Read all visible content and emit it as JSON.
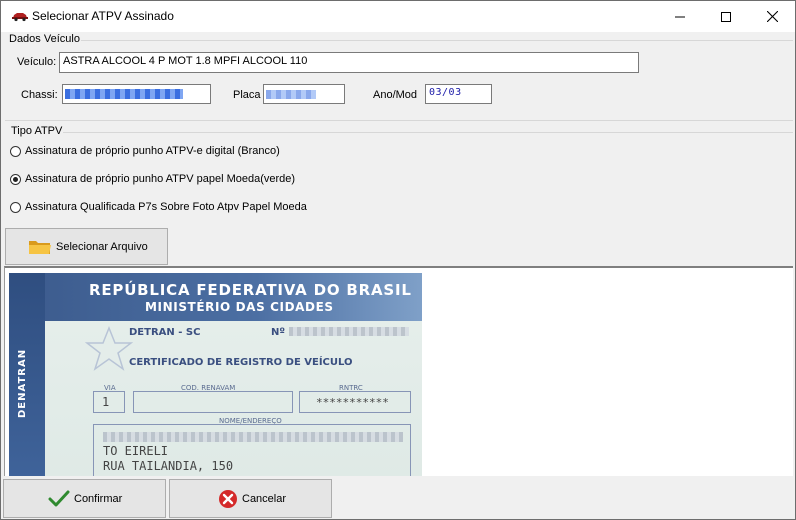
{
  "window": {
    "title": "Selecionar ATPV Assinado",
    "minimize_icon": "minimize-icon",
    "maximize_icon": "maximize-icon",
    "close_icon": "close-icon"
  },
  "dados_veiculo": {
    "group_label": "Dados Veículo",
    "veiculo_label": "Veículo:",
    "veiculo_value": "ASTRA ALCOOL 4 P MOT 1.8 MPFI ALCOOL 110",
    "chassi_label": "Chassi:",
    "placa_label": "Placa",
    "anomod_label": "Ano/Mod",
    "anomod_value": "03/03"
  },
  "tipo_atpv": {
    "group_label": "Tipo ATPV",
    "options": [
      {
        "label": "Assinatura de próprio punho ATPV-e digital (Branco)",
        "checked": false
      },
      {
        "label": "Assinatura de próprio punho ATPV papel Moeda(verde)",
        "checked": true
      },
      {
        "label": "Assinatura Qualificada P7s Sobre Foto Atpv Papel Moeda",
        "checked": false
      }
    ]
  },
  "toolbar": {
    "select_file_label": "Selecionar Arquivo",
    "select_file_icon": "folder-icon"
  },
  "document_preview": {
    "sidebar_text": "DENATRAN",
    "title1": "REPÚBLICA FEDERATIVA DO BRASIL",
    "title2": "MINISTÉRIO DAS CIDADES",
    "detran": "DETRAN - SC",
    "numero_label": "Nº",
    "certificado": "CERTIFICADO DE REGISTRO DE VEÍCULO",
    "via_label": "VIA",
    "via_value": "1",
    "renavam_label": "COD. RENAVAM",
    "rntrc_label": "RNTRC",
    "rntrc_value": "***********",
    "nome_label": "NOME/ENDEREÇO",
    "nome_line1": "TO EIRELI",
    "nome_line2": "RUA TAILANDIA, 150"
  },
  "footer": {
    "confirm_label": "Confirmar",
    "confirm_icon": "checkmark-icon",
    "cancel_label": "Cancelar",
    "cancel_icon": "cancel-icon"
  },
  "colors": {
    "window_bg": "#f0f0f0",
    "title_bg": "#ffffff",
    "doc_header": "#3b5a8c",
    "cancel_red": "#d42a2a",
    "confirm_green": "#2f8a2f"
  }
}
